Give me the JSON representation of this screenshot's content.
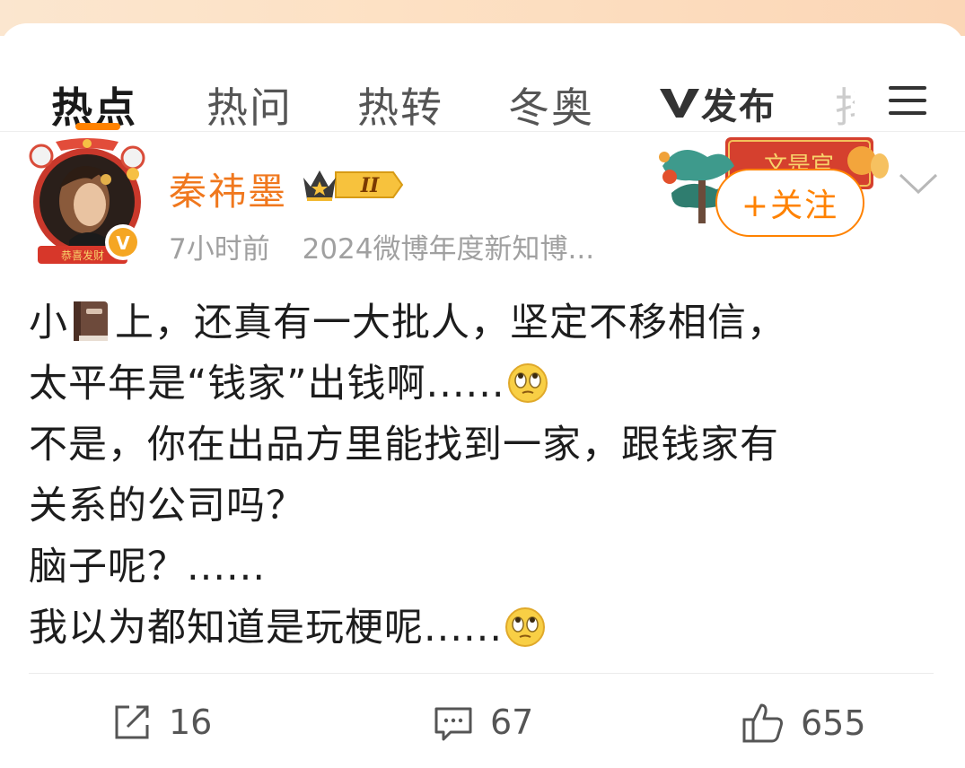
{
  "tabs": [
    {
      "label": "热点",
      "active": true
    },
    {
      "label": "热问",
      "active": false
    },
    {
      "label": "热转",
      "active": false
    },
    {
      "label": "冬奥",
      "active": false
    },
    {
      "label": "发布",
      "active": false,
      "logo": "V-logo"
    },
    {
      "label": "抖",
      "active": false,
      "partial": true
    }
  ],
  "accent_color": "#ff8200",
  "post": {
    "username": "秦祎墨",
    "badge_level": "II",
    "avatar_caption": "恭喜发财",
    "time": "7小时前",
    "source": "2024微博年度新知博...",
    "follow_label": "+关注",
    "banner_text": "文是官",
    "content_lines": [
      {
        "before": "小",
        "icon": "book-icon",
        "after": "上，还真有一大批人，坚定不移相信，"
      },
      {
        "text": "太平年是“钱家”出钱啊......",
        "icon": "rolling-eyes-emoji"
      },
      {
        "text": "不是，你在出品方里能找到一家，跟钱家有"
      },
      {
        "text": "关系的公司吗？"
      },
      {
        "text": "脑子呢？......"
      },
      {
        "text": "我以为都知道是玩梗呢......",
        "icon": "rolling-eyes-emoji"
      }
    ],
    "actions": {
      "repost": "16",
      "comment": "67",
      "like": "655"
    }
  }
}
